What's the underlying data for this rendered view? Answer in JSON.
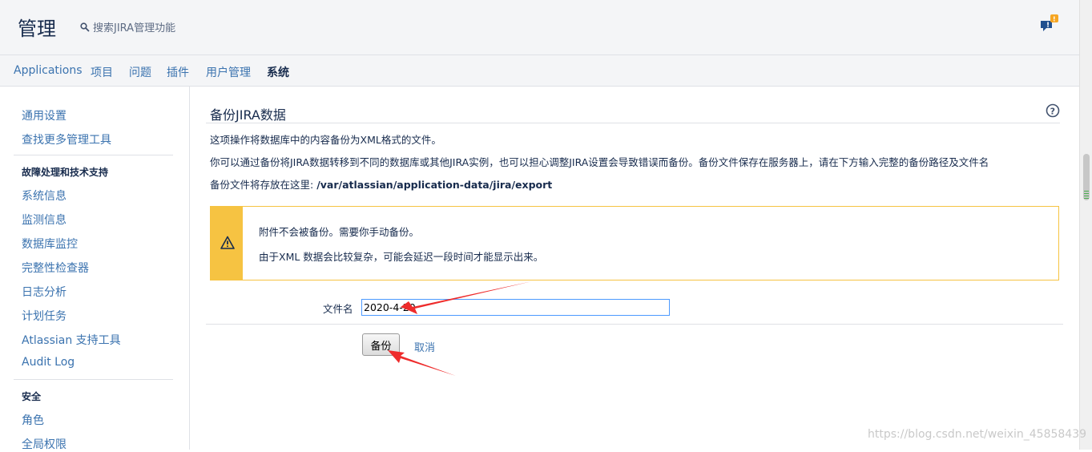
{
  "header": {
    "admin_title": "管理",
    "search_label": "搜索JIRA管理功能",
    "feedback_badge": "!"
  },
  "tabs": [
    {
      "label": "Applications",
      "active": false
    },
    {
      "label": "项目",
      "active": false
    },
    {
      "label": "问题",
      "active": false
    },
    {
      "label": "插件",
      "active": false
    },
    {
      "label": "用户管理",
      "active": false
    },
    {
      "label": "系统",
      "active": true
    }
  ],
  "sidebar": {
    "general_settings": "通用设置",
    "find_more_tools": "查找更多管理工具",
    "section_troubleshooting": "故障处理和技术支持",
    "system_info": "系统信息",
    "monitoring": "监测信息",
    "db_monitoring": "数据库监控",
    "integrity_checker": "完整性检查器",
    "log_analysis": "日志分析",
    "scheduled_tasks": "计划任务",
    "support_tools": "Atlassian 支持工具",
    "audit_log": "Audit Log",
    "section_security": "安全",
    "roles": "角色",
    "global_permissions": "全局权限"
  },
  "main": {
    "title": "备份JIRA数据",
    "intro": "这项操作将数据库中的内容备份为XML格式的文件。",
    "description": "你可以通过备份将JIRA数据转移到不同的数据库或其他JIRA实例，也可以担心调整JIRA设置会导致错误而备份。备份文件保存在服务器上，请在下方输入完整的备份路径及文件名",
    "location_prefix": "备份文件将存放在这里: ",
    "location_path": "/var/atlassian/application-data/jira/export",
    "warning_line1": "附件不会被备份。需要你手动备份。",
    "warning_line2": "由于XML 数据会比较复杂，可能会延迟一段时间才能显示出来。",
    "filename_label": "文件名",
    "filename_value": "2020-4-20",
    "backup_button": "备份",
    "cancel_link": "取消"
  },
  "watermark": "https://blog.csdn.net/weixin_45858439",
  "colors": {
    "link": "#3b73af",
    "warning": "#f6c342",
    "annotation_arrow": "#ee2b2b"
  }
}
